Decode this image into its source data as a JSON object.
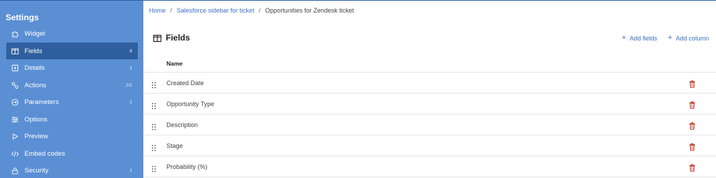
{
  "sidebar": {
    "title": "Settings",
    "items": [
      {
        "label": "Widget",
        "count": "",
        "icon": "puzzle-icon"
      },
      {
        "label": "Fields",
        "count": "6",
        "icon": "columns-icon",
        "active": true
      },
      {
        "label": "Details",
        "count": "1",
        "icon": "plus-square-icon"
      },
      {
        "label": "Actions",
        "count": "2/2",
        "icon": "actions-icon"
      },
      {
        "label": "Parameters",
        "count": "1",
        "icon": "circle-arrow-icon"
      },
      {
        "label": "Options",
        "count": "",
        "icon": "sliders-icon"
      },
      {
        "label": "Preview",
        "count": "",
        "icon": "play-icon"
      },
      {
        "label": "Embed codes",
        "count": "",
        "icon": "code-icon"
      },
      {
        "label": "Security",
        "count": "1",
        "icon": "lock-icon"
      }
    ]
  },
  "breadcrumb": {
    "home": "Home",
    "parent": "Salesforce sidebar for ticket",
    "current": "Opportunities for Zendesk ticket",
    "separator": "/"
  },
  "section": {
    "title": "Fields",
    "add_fields": "Add fields",
    "add_column": "Add column",
    "plus": "+"
  },
  "table": {
    "column_header": "Name",
    "rows": [
      {
        "name": "Created Date"
      },
      {
        "name": "Opportunity Type"
      },
      {
        "name": "Description"
      },
      {
        "name": "Stage"
      },
      {
        "name": "Probability (%)"
      }
    ]
  },
  "colors": {
    "sidebar_bg": "#5a8fd4",
    "sidebar_active": "#2f5f9e",
    "link": "#3a6fc4",
    "delete": "#c0392b"
  }
}
